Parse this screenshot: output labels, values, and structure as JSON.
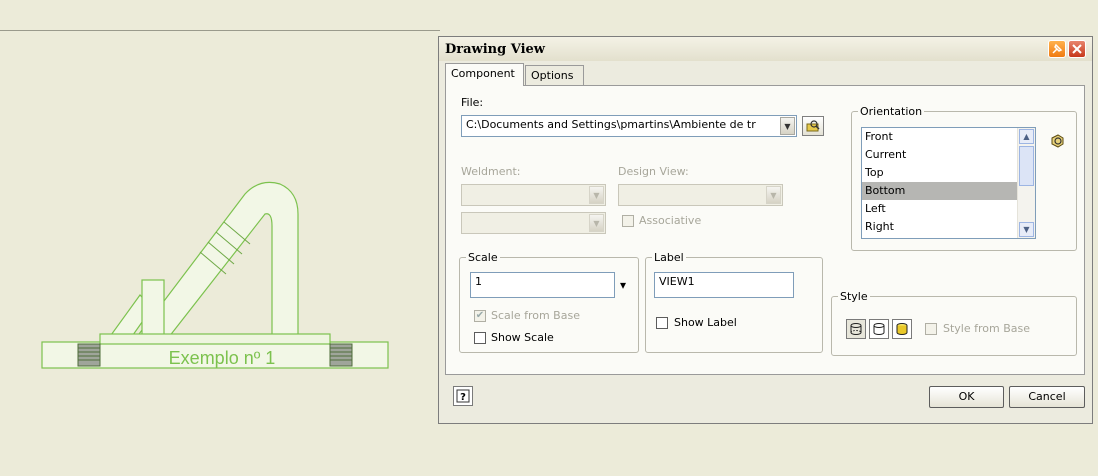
{
  "drawing": {
    "part_label": "Exemplo nº 1"
  },
  "dialog": {
    "title": "Drawing View",
    "tabs": [
      {
        "label": "Component"
      },
      {
        "label": "Options"
      }
    ],
    "file": {
      "label": "File:",
      "value": "C:\\Documents and Settings\\pmartins\\Ambiente de tr"
    },
    "weldment": {
      "label": "Weldment:"
    },
    "design_view": {
      "label": "Design View:"
    },
    "associative": {
      "label": "Associative"
    },
    "scale": {
      "group_title": "Scale",
      "value": "1",
      "scale_from_base": "Scale from Base",
      "show_scale": "Show Scale"
    },
    "label": {
      "group_title": "Label",
      "value": "VIEW1",
      "show_label": "Show Label"
    },
    "orientation": {
      "group_title": "Orientation",
      "items": [
        "Front",
        "Current",
        "Top",
        "Bottom",
        "Left",
        "Right"
      ],
      "selected": "Bottom"
    },
    "style": {
      "group_title": "Style",
      "style_from_base": "Style from Base"
    },
    "buttons": {
      "ok": "OK",
      "cancel": "Cancel",
      "help": "?"
    }
  },
  "colors": {
    "part_outline": "#7cc24e",
    "selection": "#b6b6b3",
    "background": "#ecebd9"
  }
}
